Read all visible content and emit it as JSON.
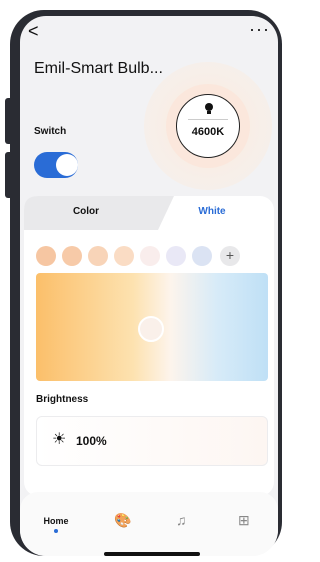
{
  "header": {
    "back_icon": "chevron-left-icon",
    "back_glyph": "<",
    "more_icon": "more-dots-icon",
    "more_glyph": "···",
    "title": "Emil-Smart Bulb..."
  },
  "dial": {
    "icon": "lightbulb-icon",
    "temperature": "4600K"
  },
  "switch": {
    "label": "Switch",
    "on": true,
    "accent": "#2a6cd6"
  },
  "tabs": [
    {
      "label": "Color",
      "active": false
    },
    {
      "label": "White",
      "active": true
    }
  ],
  "presets": {
    "swatches": [
      "#f6c6a2",
      "#f7caa8",
      "#f8d4b8",
      "#fadcc4",
      "#f9edec",
      "#e9e8f6",
      "#dbe3f3"
    ],
    "add_icon": "plus-icon",
    "add_glyph": "+"
  },
  "brightness": {
    "label": "Brightness",
    "icon": "sun-icon",
    "icon_glyph": "☀",
    "value": "100%",
    "fraction": 1.0
  },
  "bottom_nav": {
    "items": [
      {
        "label": "Home",
        "icon": "home-icon",
        "active": true
      },
      {
        "label": "",
        "icon": "palette-icon",
        "glyph": "🎨"
      },
      {
        "label": "",
        "icon": "music-icon",
        "glyph": "♫"
      },
      {
        "label": "",
        "icon": "grid-icon",
        "glyph": "⊞"
      }
    ]
  }
}
